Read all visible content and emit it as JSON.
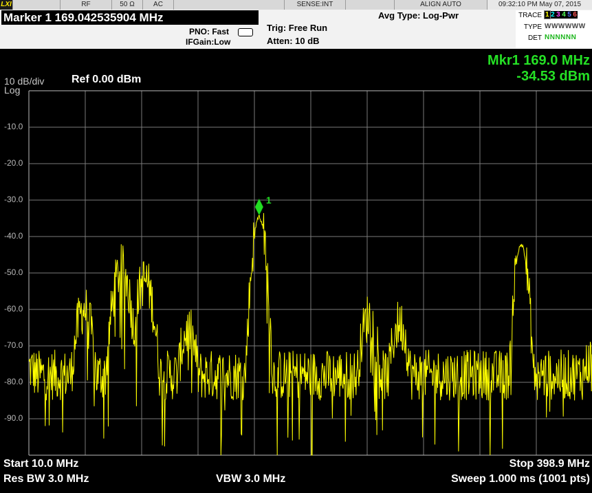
{
  "statusbar": {
    "lxi": "LXI",
    "rf": "RF",
    "impedance": "50 Ω",
    "coupling": "AC",
    "sense": "SENSE:INT",
    "align": "ALIGN AUTO",
    "datetime": "09:32:10 PM May 07, 2015"
  },
  "marker_panel": {
    "title": "Marker 1 169.042535904 MHz",
    "pno": "PNO: Fast",
    "ifgain": "IFGain:Low",
    "trig": "Trig: Free Run",
    "atten": "Atten: 10 dB",
    "avg_type": "Avg Type: Log-Pwr"
  },
  "trace_panel": {
    "trace_label": "TRACE",
    "type_label": "TYPE",
    "det_label": "DET",
    "trace_digits": [
      "1",
      "2",
      "3",
      "4",
      "5",
      "6"
    ],
    "trace_colors": [
      "#ffff00",
      "#00ffff",
      "#ff44ff",
      "#55ff55",
      "#5577ff",
      "#ff5555"
    ],
    "type_values": "WWWWWW",
    "det_values": "NNNNNN"
  },
  "display": {
    "scale": "10 dB/div",
    "scale_mode": "Log",
    "ref_level": "Ref 0.00 dBm",
    "mkr_freq": "Mkr1 169.0 MHz",
    "mkr_level": "-34.53 dBm",
    "marker_number": "1"
  },
  "bottom": {
    "start": "Start 10.0 MHz",
    "stop": "Stop 398.9 MHz",
    "rbw": "Res BW 3.0 MHz",
    "vbw": "VBW 3.0 MHz",
    "sweep": "Sweep  1.000 ms (1001 pts)"
  },
  "chart_data": {
    "type": "line",
    "xlabel": "",
    "ylabel": "",
    "xlim": [
      10.0,
      398.9
    ],
    "ylim": [
      -100,
      0
    ],
    "y_tick_labels": [
      "-10.0",
      "-20.0",
      "-30.0",
      "-40.0",
      "-50.0",
      "-60.0",
      "-70.0",
      "-80.0",
      "-90.0"
    ],
    "grid": true,
    "trace_color": "#ffff00",
    "noise_floor_db": -78,
    "series": [
      {
        "name": "",
        "features": [
          {
            "x_mhz": 10.0,
            "y_db": -76
          },
          {
            "x_mhz": 48.0,
            "y_db": -60
          },
          {
            "x_mhz": 74.0,
            "y_db": -49
          },
          {
            "x_mhz": 90.0,
            "y_db": -52
          },
          {
            "x_mhz": 120.0,
            "y_db": -66
          },
          {
            "x_mhz": 169.0,
            "y_db": -34.53
          },
          {
            "x_mhz": 245.0,
            "y_db": -62
          },
          {
            "x_mhz": 266.0,
            "y_db": -64
          },
          {
            "x_mhz": 350.0,
            "y_db": -42
          },
          {
            "x_mhz": 398.9,
            "y_db": -74
          }
        ]
      }
    ],
    "marker": {
      "x_mhz": 169.0,
      "y_db": -34.53,
      "label": "1",
      "color": "#22dd22"
    }
  }
}
